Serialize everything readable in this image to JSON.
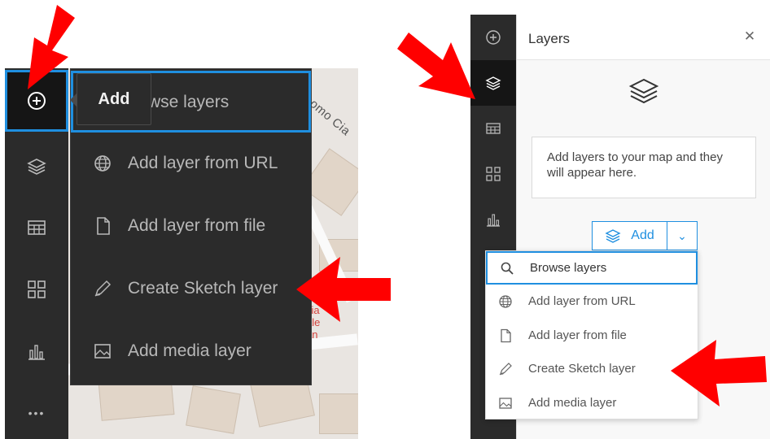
{
  "left_panel": {
    "map": {
      "street_label": "como Cia",
      "poi_label": [
        "cia",
        "ale",
        "an"
      ]
    },
    "toolbar": {
      "tools": [
        {
          "icon": "add-circle-icon",
          "name": "Add"
        },
        {
          "icon": "layers-icon"
        },
        {
          "icon": "table-icon"
        },
        {
          "icon": "widgets-icon"
        },
        {
          "icon": "chart-icon"
        },
        {
          "icon": "more-icon",
          "text": "•••"
        }
      ]
    },
    "tooltip": "Add",
    "add_menu": {
      "browse_partial": "wse layers",
      "items": [
        {
          "label": "Add layer from URL",
          "icon": "globe-icon"
        },
        {
          "label": "Add layer from file",
          "icon": "file-icon"
        },
        {
          "label": "Create Sketch layer",
          "icon": "sketch-icon"
        },
        {
          "label": "Add media layer",
          "icon": "media-icon"
        }
      ]
    }
  },
  "right_panel": {
    "toolbar": {
      "tools": [
        {
          "icon": "add-circle-icon"
        },
        {
          "icon": "layers-icon",
          "active": true
        },
        {
          "icon": "table-icon"
        },
        {
          "icon": "widgets-icon"
        },
        {
          "icon": "chart-icon"
        }
      ]
    },
    "layers_panel": {
      "title": "Layers",
      "close_icon": "close-icon",
      "empty_message": "Add layers to your map and they will appear here.",
      "add_button_label": "Add"
    },
    "add_menu": {
      "items": [
        {
          "label": "Browse layers",
          "icon": "search-icon"
        },
        {
          "label": "Add layer from URL",
          "icon": "globe-icon"
        },
        {
          "label": "Add layer from file",
          "icon": "file-icon"
        },
        {
          "label": "Create Sketch layer",
          "icon": "sketch-icon"
        },
        {
          "label": "Add media layer",
          "icon": "media-icon"
        }
      ]
    }
  },
  "colors": {
    "toolbar_bg": "#2b2b2b",
    "active_tool_bg": "#151515",
    "focus_blue": "#1f8fe0",
    "annotation_arrow": "#ff0000",
    "map_bg": "#e9e5e1"
  }
}
